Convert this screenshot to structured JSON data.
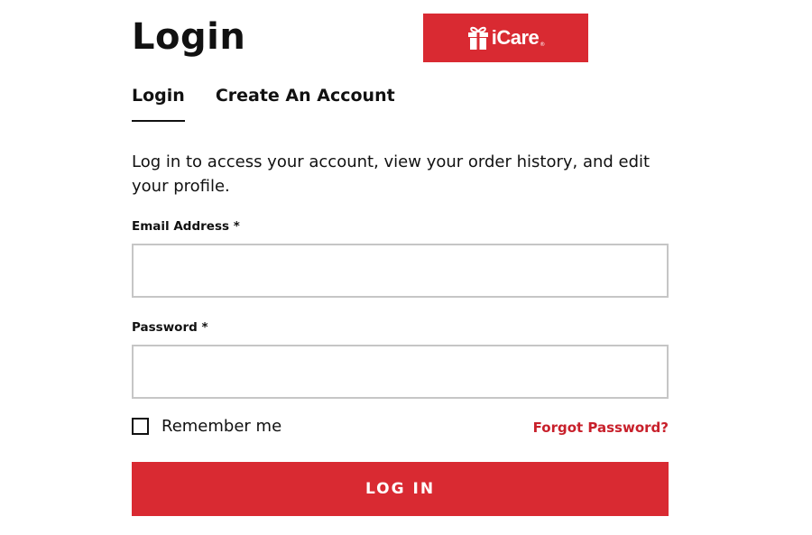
{
  "header": {
    "title": "Login"
  },
  "brand": {
    "name": "iCare",
    "reg_mark": "®",
    "color": "#d92a32"
  },
  "tabs": [
    {
      "label": "Login",
      "active": true
    },
    {
      "label": "Create An Account",
      "active": false
    }
  ],
  "intro_text": "Log in to access your account, view your order history, and edit your profile.",
  "form": {
    "email_label": "Email Address *",
    "email_value": "",
    "password_label": "Password *",
    "password_value": "",
    "remember_label": "Remember me",
    "remember_checked": false,
    "forgot_label": "Forgot Password?",
    "submit_label": "LOG IN"
  },
  "colors": {
    "accent": "#d92a32",
    "link": "#c8202b",
    "text": "#111111",
    "input_border": "#c6c6c6"
  }
}
